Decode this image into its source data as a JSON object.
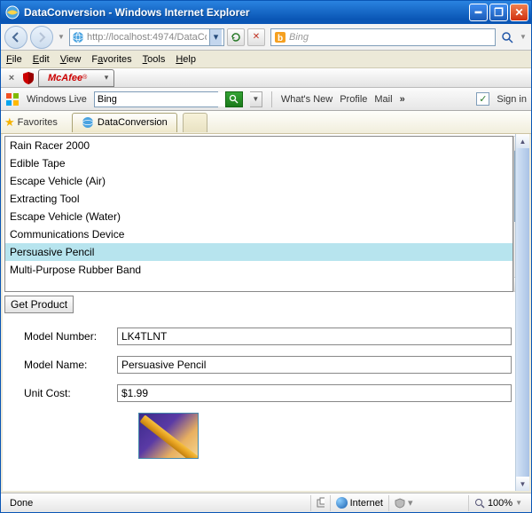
{
  "window": {
    "title": "DataConversion - Windows Internet Explorer"
  },
  "nav": {
    "url_display": "http://localhost:4974/DataConver",
    "search_provider": "Bing"
  },
  "menu": {
    "file": "File",
    "edit": "Edit",
    "view": "View",
    "favorites": "Favorites",
    "tools": "Tools",
    "help": "Help"
  },
  "mcafee": {
    "close_x": "×",
    "label": "McAfee"
  },
  "wl": {
    "brand": "Windows Live",
    "search_value": "Bing",
    "whatsnew": "What's New",
    "profile": "Profile",
    "mail": "Mail",
    "more": "»",
    "signin": "Sign in"
  },
  "favbar": {
    "favorites": "Favorites",
    "tab_title": "DataConversion"
  },
  "list": {
    "items": [
      "Rain Racer 2000",
      "Edible Tape",
      "Escape Vehicle (Air)",
      "Extracting Tool",
      "Escape Vehicle (Water)",
      "Communications Device",
      "Persuasive Pencil",
      "Multi-Purpose Rubber Band"
    ],
    "selected_index": 6
  },
  "buttons": {
    "get_product": "Get Product"
  },
  "form": {
    "labels": {
      "model_number": "Model Number:",
      "model_name": "Model Name:",
      "unit_cost": "Unit Cost:"
    },
    "values": {
      "model_number": "LK4TLNT",
      "model_name": "Persuasive Pencil",
      "unit_cost": "$1.99"
    }
  },
  "status": {
    "done": "Done",
    "zone": "Internet",
    "protected_off": "",
    "zoom": "100%"
  }
}
